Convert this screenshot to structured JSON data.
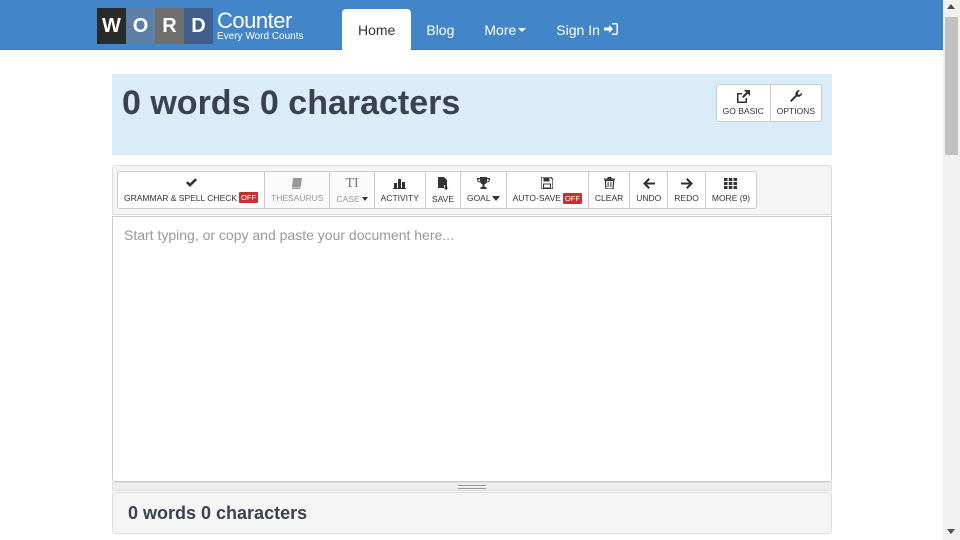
{
  "logo": {
    "letters": [
      "W",
      "O",
      "R",
      "D"
    ],
    "title": "Counter",
    "subtitle": "Every Word Counts"
  },
  "nav": {
    "home": "Home",
    "blog": "Blog",
    "more": "More",
    "signin": "Sign In"
  },
  "header": {
    "count_text": "0 words 0 characters",
    "go_basic": "GO BASIC",
    "options": "OPTIONS"
  },
  "toolbar": {
    "grammar": "GRAMMAR & SPELL CHECK",
    "grammar_badge": "OFF",
    "thesaurus": "THESAURUS",
    "case": "CASE",
    "case_icon": "TI",
    "activity": "ACTIVITY",
    "save": "SAVE",
    "goal": "GOAL",
    "autosave": "AUTO-SAVE",
    "autosave_badge": "OFF",
    "clear": "CLEAR",
    "undo": "UNDO",
    "redo": "REDO",
    "more": "MORE (9)"
  },
  "editor": {
    "value": "",
    "placeholder": "Start typing, or copy and paste your document here..."
  },
  "footer": {
    "count_text": "0 words 0 characters"
  },
  "colors": {
    "navbar": "#4285c8",
    "header_panel": "#d9ecf7",
    "badge_off": "#c9302c"
  }
}
